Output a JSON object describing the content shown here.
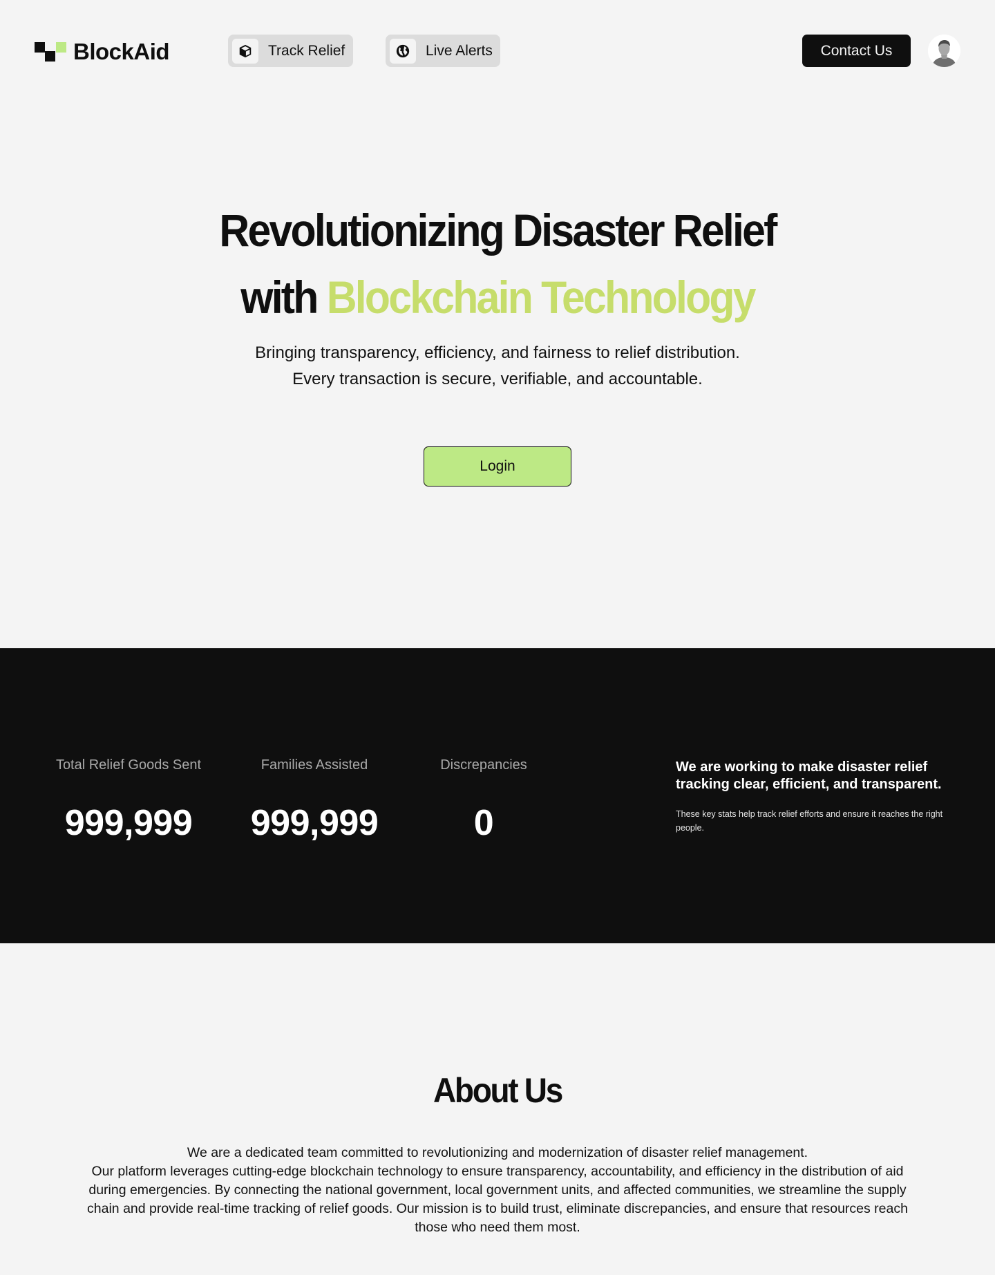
{
  "header": {
    "logo_text": "BlockAid",
    "nav": [
      {
        "label": "Track Relief",
        "icon": "cube-icon"
      },
      {
        "label": "Live Alerts",
        "icon": "globe-icon"
      }
    ],
    "contact_label": "Contact Us",
    "avatar_icon": "user-avatar-icon"
  },
  "hero": {
    "title_line1": "Revolutionizing Disaster Relief",
    "title_line2_prefix": "with",
    "title_line2_accent": "Blockchain Technology",
    "subtitle_line1": "Bringing transparency, efficiency, and fairness to relief distribution.",
    "subtitle_line2": "Every transaction is secure, verifiable, and accountable.",
    "login_label": "Login"
  },
  "stats": {
    "items": [
      {
        "label": "Total Relief Goods Sent",
        "value": "999,999"
      },
      {
        "label": "Families Assisted",
        "value": "999,999"
      },
      {
        "label": "Discrepancies",
        "value": "0"
      }
    ],
    "blurb_heading": "We are working to make disaster relief tracking clear, efficient, and transparent.",
    "blurb_body": "These key stats help track relief efforts and ensure it reaches the right people."
  },
  "about": {
    "title": "About Us",
    "line1": "We are a dedicated team committed to revolutionizing and modernization of disaster relief management.",
    "paragraph": "Our platform leverages cutting-edge blockchain technology to ensure transparency, accountability, and efficiency in the distribution of aid during emergencies. By connecting the national government, local government units, and affected communities, we streamline the supply chain and provide real-time tracking of relief goods. Our mission is to build trust, eliminate discrepancies, and ensure that resources reach those who need them most."
  },
  "colors": {
    "background": "#f4f4f4",
    "dark": "#0f0f0f",
    "accent_green": "#bde985",
    "accent_text": "#c6dd6b",
    "pill_gray": "#dcdcdc"
  }
}
